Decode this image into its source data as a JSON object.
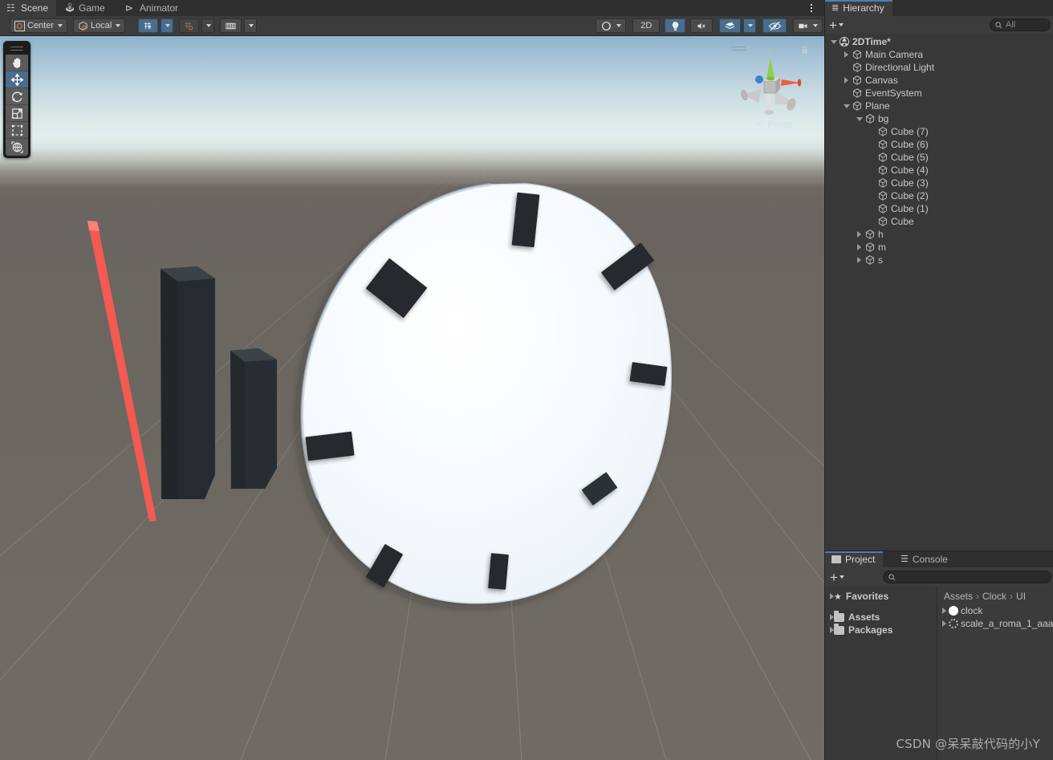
{
  "scene_panel": {
    "tabs": [
      {
        "label": "Scene",
        "icon": "grid-icon",
        "active": true
      },
      {
        "label": "Game",
        "icon": "gamepad-icon",
        "active": false
      },
      {
        "label": "Animator",
        "icon": "animator-icon",
        "active": false
      }
    ],
    "overflow_menu": "more-options-icon",
    "toolbar": {
      "pivot_mode": "Center",
      "handle_space": "Local",
      "grid_snap_label": "grid-snap-toggle",
      "snap_increment_label": "snap-increment-toggle",
      "ruler_label": "ruler-toggle",
      "draw_mode": "shaded-draw-mode",
      "two_d_label": "2D",
      "lighting_label": "scene-lighting-toggle",
      "audio_label": "scene-audio-toggle",
      "fx_label": "effects-toggle",
      "visibility_label": "scene-visibility-toggle",
      "camera_label": "scene-camera-settings",
      "gizmos_label": "gizmos-toggle"
    },
    "tools": [
      {
        "name": "hand-tool",
        "active": false
      },
      {
        "name": "move-tool",
        "active": true
      },
      {
        "name": "rotate-tool",
        "active": false
      },
      {
        "name": "scale-tool",
        "active": false
      },
      {
        "name": "rect-tool",
        "active": false
      },
      {
        "name": "transform-tool",
        "active": false
      }
    ],
    "gizmo": {
      "axis_x": "x",
      "axis_y": "y",
      "axis_z": "z",
      "projection_label": "Persp",
      "projection_arrow": "≺",
      "colors": {
        "x": "#f05a3c",
        "y": "#8ccf4a",
        "z": "#3d7fd1"
      }
    },
    "viewport": {
      "sky_top_color": "#8fb2cc",
      "horizon_color": "#e3eeec",
      "ground_color": "#6b6660",
      "clock_face_color": "#f4f8fc",
      "tick_color": "#262626",
      "hand_second_color": "#f4554b",
      "hand_dark_color": "#262b30",
      "tick_count": 8,
      "hand_count": 3
    },
    "watermark": "CSDN @呆呆敲代码的小Y"
  },
  "hierarchy": {
    "tab_label": "Hierarchy",
    "tab_icon": "hierarchy-icon",
    "create_label": "+",
    "search_placeholder": "All",
    "search_value": "",
    "tree": [
      {
        "label": "2DTime*",
        "depth": 0,
        "twisty": "down",
        "icon": "unity-scene-icon"
      },
      {
        "label": "Main Camera",
        "depth": 1,
        "twisty": "right",
        "icon": "gameobject-icon"
      },
      {
        "label": "Directional Light",
        "depth": 1,
        "twisty": "none",
        "icon": "gameobject-icon"
      },
      {
        "label": "Canvas",
        "depth": 1,
        "twisty": "right",
        "icon": "gameobject-icon"
      },
      {
        "label": "EventSystem",
        "depth": 1,
        "twisty": "none",
        "icon": "gameobject-icon"
      },
      {
        "label": "Plane",
        "depth": 1,
        "twisty": "down",
        "icon": "gameobject-icon"
      },
      {
        "label": "bg",
        "depth": 2,
        "twisty": "down",
        "icon": "gameobject-icon"
      },
      {
        "label": "Cube (7)",
        "depth": 3,
        "twisty": "none",
        "icon": "gameobject-icon"
      },
      {
        "label": "Cube (6)",
        "depth": 3,
        "twisty": "none",
        "icon": "gameobject-icon"
      },
      {
        "label": "Cube (5)",
        "depth": 3,
        "twisty": "none",
        "icon": "gameobject-icon"
      },
      {
        "label": "Cube (4)",
        "depth": 3,
        "twisty": "none",
        "icon": "gameobject-icon"
      },
      {
        "label": "Cube (3)",
        "depth": 3,
        "twisty": "none",
        "icon": "gameobject-icon"
      },
      {
        "label": "Cube (2)",
        "depth": 3,
        "twisty": "none",
        "icon": "gameobject-icon"
      },
      {
        "label": "Cube (1)",
        "depth": 3,
        "twisty": "none",
        "icon": "gameobject-icon"
      },
      {
        "label": "Cube",
        "depth": 3,
        "twisty": "none",
        "icon": "gameobject-icon"
      },
      {
        "label": "h",
        "depth": 2,
        "twisty": "right",
        "icon": "gameobject-icon"
      },
      {
        "label": "m",
        "depth": 2,
        "twisty": "right",
        "icon": "gameobject-icon"
      },
      {
        "label": "s",
        "depth": 2,
        "twisty": "right",
        "icon": "gameobject-icon"
      }
    ]
  },
  "project": {
    "tabs": [
      {
        "label": "Project",
        "icon": "folder-icon",
        "active": true
      },
      {
        "label": "Console",
        "icon": "console-icon",
        "active": false
      }
    ],
    "create_label": "+",
    "search_placeholder": "",
    "search_value": "",
    "sidebar": [
      {
        "label": "Favorites",
        "icon": "star-icon",
        "twisty": "right"
      },
      {
        "label": "",
        "icon": "none",
        "twisty": "none"
      },
      {
        "label": "Assets",
        "icon": "folder-icon",
        "twisty": "right"
      },
      {
        "label": "Packages",
        "icon": "folder-icon",
        "twisty": "right"
      }
    ],
    "breadcrumb": [
      "Assets",
      "Clock",
      "UI"
    ],
    "breadcrumb_separator": "›",
    "assets": [
      {
        "label": "clock",
        "icon": "sprite-icon",
        "twisty": "right"
      },
      {
        "label": "scale_a_roma_1_aaa",
        "icon": "sprite-dotted-icon",
        "twisty": "right"
      }
    ]
  }
}
